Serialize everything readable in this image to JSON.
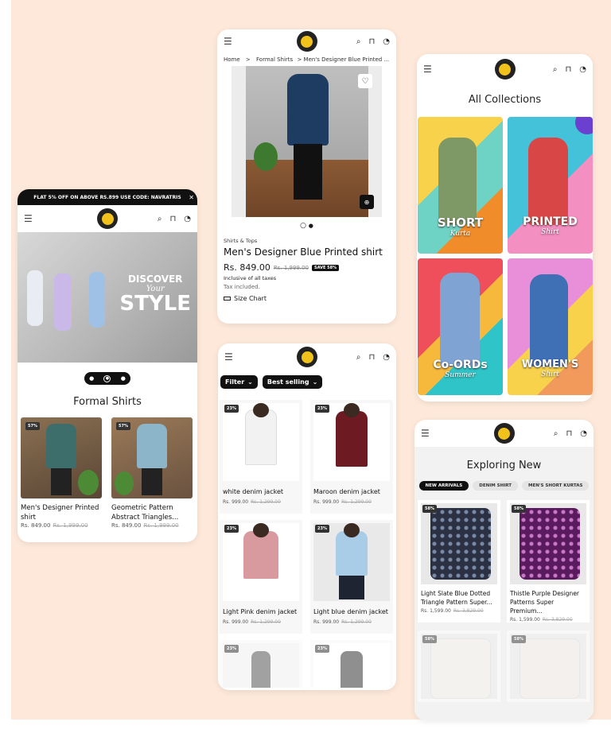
{
  "home": {
    "announcement": "FLAT 5% OFF ON ABOVE RS.899 USE CODE: NAVRATRIS",
    "banner": {
      "line1": "DISCOVER",
      "line2": "Your",
      "line3": "STYLE"
    },
    "section_title": "Formal Shirts",
    "products": [
      {
        "badge": "57%",
        "name": "Men's Designer Printed shirt",
        "price": "Rs. 849.00",
        "compare": "Rs. 1,999.00"
      },
      {
        "badge": "57%",
        "name": "Geometric Pattern Abstract Triangles...",
        "price": "Rs. 849.00",
        "compare": "Rs. 1,999.00"
      }
    ]
  },
  "product": {
    "breadcrumb": {
      "home": "Home",
      "sep": ">",
      "category": "Formal Shirts",
      "current": "> Men's Designer Blue Printed ..."
    },
    "category": "Shirts & Tops",
    "title": "Men's Designer Blue Printed shirt",
    "price": "Rs. 849.00",
    "compare": "Rs. 1,999.00",
    "save": "SAVE 58%",
    "taxes": "Inclusive of all taxes",
    "tax_included": "Tax included.",
    "size_chart": "Size Chart"
  },
  "listing": {
    "filter": "Filter",
    "sort": "Best selling",
    "products": [
      {
        "badge": "23%",
        "name": "white denim jacket",
        "price": "Rs. 999.00",
        "compare": "Rs. 1,299.00"
      },
      {
        "badge": "23%",
        "name": "Maroon denim jacket",
        "price": "Rs. 999.00",
        "compare": "Rs. 1,299.00"
      },
      {
        "badge": "23%",
        "name": "Light Pink denim jacket",
        "price": "Rs. 999.00",
        "compare": "Rs. 1,299.00"
      },
      {
        "badge": "23%",
        "name": "Light blue denim jacket",
        "price": "Rs. 999.00",
        "compare": "Rs. 1,299.00"
      },
      {
        "badge": "23%"
      },
      {
        "badge": "23%"
      }
    ]
  },
  "collections": {
    "title": "All Collections",
    "items": [
      {
        "name": "SHORT",
        "sub": "Kurta"
      },
      {
        "name": "PRINTED",
        "sub": "Shirt"
      },
      {
        "name": "Co-ORDs",
        "sub": "Summer"
      },
      {
        "name": "WOMEN'S",
        "sub": "Shirt"
      }
    ]
  },
  "exploring": {
    "title": "Exploring New",
    "tabs": [
      "NEW ARRIVALS",
      "DENIM SHIRT",
      "MEN'S SHORT KURTAS"
    ],
    "products": [
      {
        "badge": "58%",
        "name": "Light Slate Blue Dotted Triangle Pattern Super...",
        "price": "Rs. 1,599.00",
        "compare": "Rs. 3,829.00"
      },
      {
        "badge": "58%",
        "name": "Thistle Purple Designer Patterns Super Premium...",
        "price": "Rs. 1,599.00",
        "compare": "Rs. 3,829.00"
      },
      {
        "badge": "58%"
      },
      {
        "badge": "58%"
      }
    ]
  }
}
